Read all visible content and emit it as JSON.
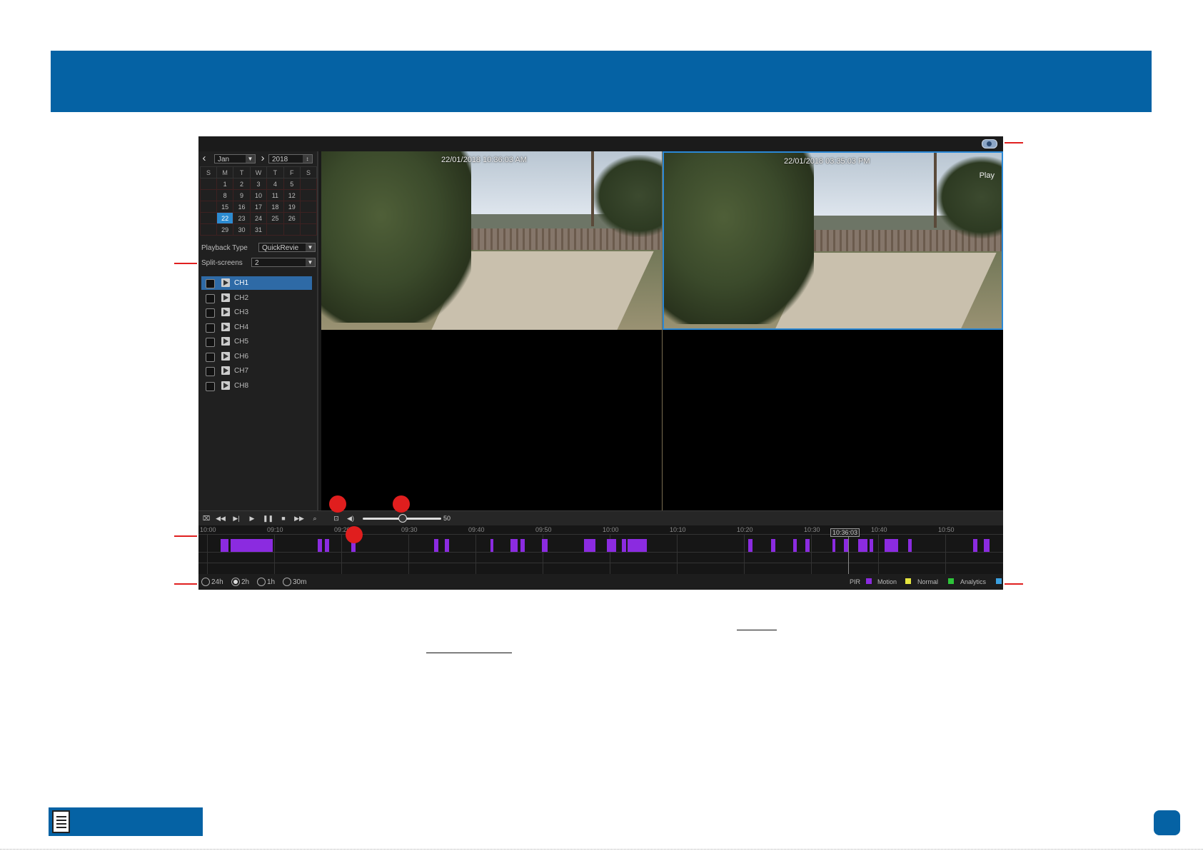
{
  "calendar": {
    "month": "Jan",
    "year": "2018",
    "weekdays": [
      "S",
      "M",
      "T",
      "W",
      "T",
      "F",
      "S"
    ],
    "weeks": [
      [
        "",
        "1",
        "2",
        "3",
        "4",
        "5",
        ""
      ],
      [
        "",
        "8",
        "9",
        "10",
        "11",
        "12",
        ""
      ],
      [
        "",
        "15",
        "16",
        "17",
        "18",
        "19",
        ""
      ],
      [
        "",
        "22",
        "23",
        "24",
        "25",
        "26",
        ""
      ],
      [
        "",
        "29",
        "30",
        "31",
        "",
        "",
        ""
      ]
    ],
    "selected_day": "22"
  },
  "playback_type": {
    "label": "Playback Type",
    "value": "QuickRevie"
  },
  "split_screens": {
    "label": "Split-screens",
    "value": "2"
  },
  "channels": [
    "CH1",
    "CH2",
    "CH3",
    "CH4",
    "CH5",
    "CH6",
    "CH7",
    "CH8"
  ],
  "cameras": [
    {
      "osd": "22/01/2018 10:36:03 AM"
    },
    {
      "osd": "22/01/2018 03:35:03 PM",
      "status": "Play"
    }
  ],
  "volume": {
    "value": "50",
    "level": 0.5
  },
  "timeline": {
    "ticks": [
      "10:00",
      "09:10",
      "09:20",
      "09:30",
      "09:40",
      "09:50",
      "10:00",
      "10:10",
      "10:20",
      "10:30",
      "10:40",
      "10:50"
    ],
    "cursor": "10:36:03",
    "record_color": "#8b2be0"
  },
  "ranges": [
    "24h",
    "2h",
    "1h",
    "30m"
  ],
  "selected_range": "2h",
  "legend": [
    {
      "label": "PIR",
      "color": "#8b2be0"
    },
    {
      "label": "Motion",
      "color": "#e6e640"
    },
    {
      "label": "Normal",
      "color": "#2ec43a"
    },
    {
      "label": "Analytics",
      "color": "#3aa0e0"
    }
  ],
  "colors": {
    "brand": "#0562a4",
    "callout": "#e01e1e",
    "selection": "#2a88d6"
  },
  "icons": {
    "exit": "exit-playback-icon",
    "page": "manual-icon"
  }
}
